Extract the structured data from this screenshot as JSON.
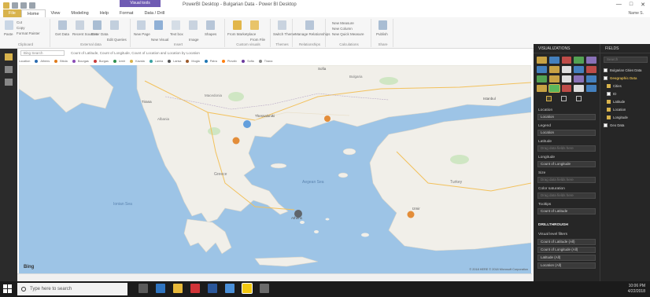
{
  "window": {
    "title": "PowerBI Desktop - Bulgarian Data - Power BI Desktop",
    "context_tab": "Visual tools",
    "user": "Name S.",
    "controls": [
      "—",
      "□",
      "✕"
    ]
  },
  "ribbon": {
    "tabs": [
      "File",
      "Home",
      "View",
      "Modeling",
      "Help",
      "Format",
      "Data / Drill"
    ],
    "active_tab": "Home",
    "groups": [
      {
        "label": "Clipboard",
        "items": [
          "Paste",
          "Cut",
          "Copy",
          "Format Painter"
        ]
      },
      {
        "label": "External data",
        "items": [
          "Get Data",
          "Recent Sources",
          "Enter Data",
          "Edit Queries"
        ]
      },
      {
        "label": "Insert",
        "items": [
          "New Page",
          "New Visual",
          "Text box",
          "Image",
          "Shapes"
        ]
      },
      {
        "label": "Custom visuals",
        "items": [
          "From Marketplace",
          "From File"
        ]
      },
      {
        "label": "Themes",
        "items": [
          "Switch Theme"
        ]
      },
      {
        "label": "Relationships",
        "items": [
          "Manage Relationships"
        ]
      },
      {
        "label": "Calculations",
        "items": [
          "New Measure",
          "New Column",
          "New Quick Measure"
        ]
      },
      {
        "label": "Share",
        "items": [
          "Publish"
        ]
      }
    ]
  },
  "filterbar": {
    "search_placeholder": "Bing Search",
    "description": "Count of Latitude, Count of Longitude, Count of Location and Location by Location"
  },
  "legend": {
    "label": "Location",
    "entries": [
      {
        "name": "Athens",
        "color": "#2b6cb0"
      },
      {
        "name": "Bitola",
        "color": "#e07b1a"
      },
      {
        "name": "Bourgas",
        "color": "#8a4bb5"
      },
      {
        "name": "Burgas",
        "color": "#c93b3b"
      },
      {
        "name": "Izmir",
        "color": "#2f8f4e"
      },
      {
        "name": "Kavala",
        "color": "#d8b34c"
      },
      {
        "name": "Lamia",
        "color": "#3aa3a3"
      },
      {
        "name": "Larisa",
        "color": "#555555"
      },
      {
        "name": "Mugla",
        "color": "#9c5a2a"
      },
      {
        "name": "Patra",
        "color": "#1f77b4"
      },
      {
        "name": "Plovdiv",
        "color": "#ff7f0e"
      },
      {
        "name": "Sofia",
        "color": "#6c3b9e"
      },
      {
        "name": "Tirana",
        "color": "#888888"
      }
    ]
  },
  "map": {
    "provider": "Bing",
    "credit": "© 2018 HERE © 2018 Microsoft Corporation",
    "labels": [
      "Greece",
      "Turkey",
      "Albania",
      "Bulgaria",
      "Macedonia",
      "Athens",
      "Izmir",
      "Aegean Sea",
      "Ionian Sea",
      "Sofia",
      "Tirana",
      "Thessaloniki",
      "Istanbul"
    ],
    "bubbles": [
      {
        "name": "Athens",
        "color": "#555555"
      },
      {
        "name": "Larisa",
        "color": "#e07b1a"
      },
      {
        "name": "Bitola",
        "color": "#4a90d9"
      },
      {
        "name": "Kavala",
        "color": "#e07b1a"
      },
      {
        "name": "Izmir",
        "color": "#e07b1a"
      }
    ]
  },
  "visualizations": {
    "title": "VISUALIZATIONS",
    "wells": [
      {
        "label": "Location",
        "value": "Location"
      },
      {
        "label": "Legend",
        "value": "Location"
      },
      {
        "label": "Latitude",
        "value": "Drag data fields here"
      },
      {
        "label": "Longitude",
        "value": "Count of Longitude"
      },
      {
        "label": "Size",
        "value": "Drag data fields here"
      },
      {
        "label": "Color saturation",
        "value": "Drag data fields here"
      },
      {
        "label": "Tooltips",
        "value": "Count of Latitude"
      }
    ],
    "drillthrough": {
      "label": "DRILLTHROUGH",
      "filters_label": "Visual level filters",
      "items": [
        "Count of Latitude (All)",
        "Count of Longitude (All)",
        "Latitude (All)",
        "Location (All)"
      ]
    }
  },
  "fields": {
    "title": "FIELDS",
    "search_placeholder": "Search",
    "tables": [
      {
        "name": "Bulgarian Cities Data",
        "checked": false
      },
      {
        "name": "Geographic Data",
        "checked": false,
        "expanded": true
      }
    ],
    "items": [
      {
        "name": "Cities",
        "checked": true
      },
      {
        "name": "ID",
        "checked": false
      },
      {
        "name": "Latitude",
        "checked": true
      },
      {
        "name": "Location",
        "checked": true
      },
      {
        "name": "Longitude",
        "checked": true
      }
    ],
    "extra_table": "Geo Data",
    "extra_table_checked": false
  },
  "taskbar": {
    "search_placeholder": "Type here to search",
    "time": "10:06 PM",
    "date": "4/22/2018"
  }
}
